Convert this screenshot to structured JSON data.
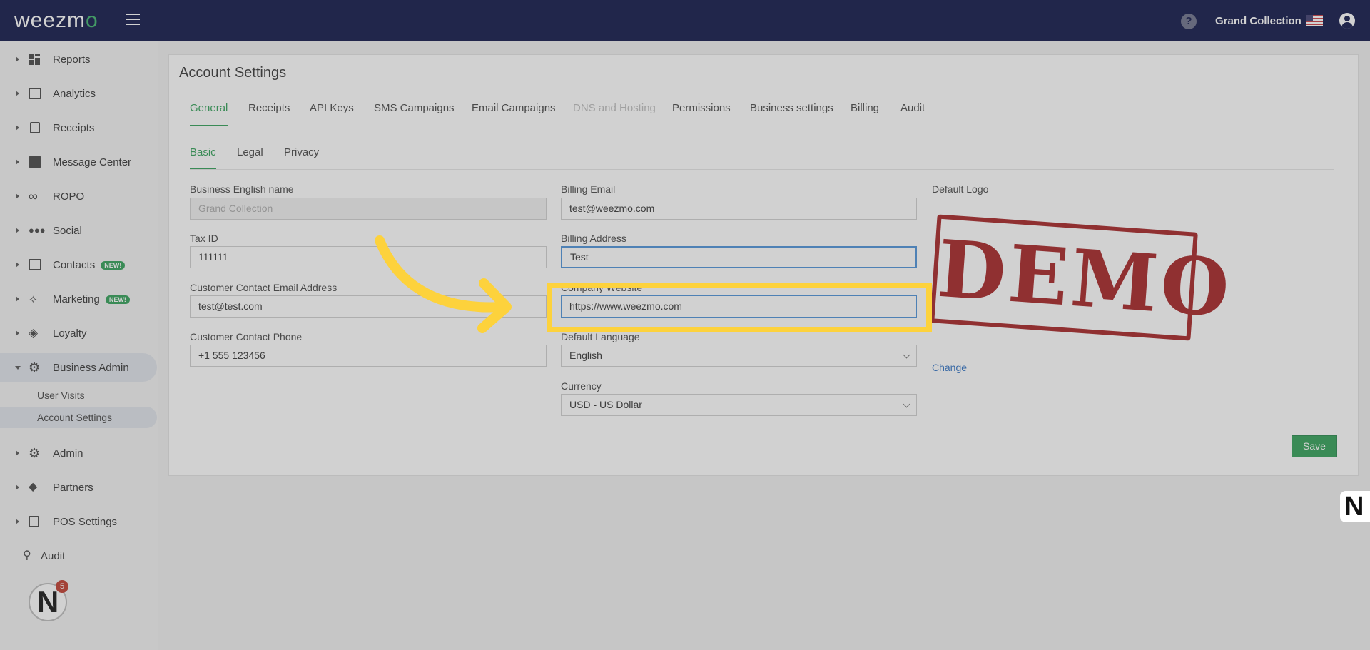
{
  "header": {
    "logo_text": "weezm",
    "logo_accent": "o",
    "org_name": "Grand Collection",
    "help_symbol": "?"
  },
  "sidebar": {
    "items": [
      {
        "label": "Reports",
        "icon": "dashboard-icon"
      },
      {
        "label": "Analytics",
        "icon": "chart-icon"
      },
      {
        "label": "Receipts",
        "icon": "receipt-icon"
      },
      {
        "label": "Message Center",
        "icon": "chat-icon"
      },
      {
        "label": "ROPO",
        "icon": "infinity-icon"
      },
      {
        "label": "Social",
        "icon": "people-icon"
      },
      {
        "label": "Contacts",
        "icon": "contacts-icon",
        "badge": "NEW!"
      },
      {
        "label": "Marketing",
        "icon": "megaphone-icon",
        "badge": "NEW!"
      },
      {
        "label": "Loyalty",
        "icon": "tag-icon"
      },
      {
        "label": "Business Admin",
        "icon": "gear-icon"
      },
      {
        "label": "Admin",
        "icon": "user-gear-icon"
      },
      {
        "label": "Partners",
        "icon": "handshake-icon"
      },
      {
        "label": "POS Settings",
        "icon": "register-icon"
      },
      {
        "label": "Audit",
        "icon": "magnifier-icon"
      }
    ],
    "sub_items": [
      "User Visits",
      "Account Settings"
    ],
    "notification_count": "5",
    "avatar_letter": "N"
  },
  "page": {
    "title": "Account Settings",
    "tabs": [
      "General",
      "Receipts",
      "API Keys",
      "SMS Campaigns",
      "Email Campaigns",
      "DNS and Hosting",
      "Permissions",
      "Business settings",
      "Billing",
      "Audit"
    ],
    "subtabs": [
      "Basic",
      "Legal",
      "Privacy"
    ]
  },
  "form": {
    "business_name_label": "Business English name",
    "business_name_value": "Grand Collection",
    "tax_id_label": "Tax ID",
    "tax_id_value": "111111",
    "contact_email_label": "Customer Contact Email Address",
    "contact_email_value": "test@test.com",
    "contact_phone_label": "Customer Contact Phone",
    "contact_phone_value": "+1 555 123456",
    "billing_email_label": "Billing Email",
    "billing_email_value": "test@weezmo.com",
    "billing_address_label": "Billing Address",
    "billing_address_value": "Test",
    "website_label": "Company Website",
    "website_value": "https://www.weezmo.com",
    "language_label": "Default Language",
    "language_value": "English",
    "currency_label": "Currency",
    "currency_value": "USD - US Dollar",
    "logo_label": "Default Logo",
    "logo_text": "DEMO",
    "change_link": "Change",
    "save_label": "Save"
  },
  "colors": {
    "topbar": "#0c1246",
    "accent": "#2e9f55",
    "highlight": "#fdd23c",
    "demo_stamp": "#a52022"
  }
}
